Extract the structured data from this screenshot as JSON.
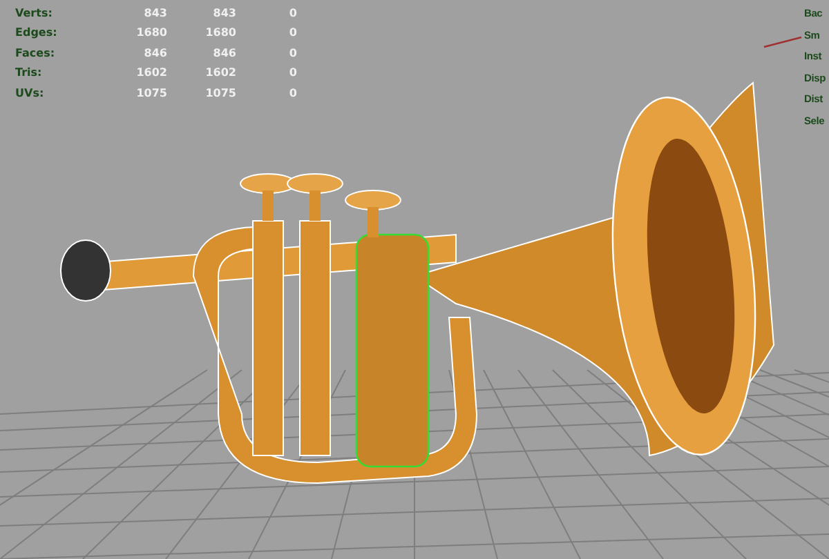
{
  "stats": [
    {
      "label": "Verts:",
      "values": [
        "843",
        "843",
        "0"
      ]
    },
    {
      "label": "Edges:",
      "values": [
        "1680",
        "1680",
        "0"
      ]
    },
    {
      "label": "Faces:",
      "values": [
        "846",
        "846",
        "0"
      ]
    },
    {
      "label": "Tris:",
      "values": [
        "1602",
        "1602",
        "0"
      ]
    },
    {
      "label": "UVs:",
      "values": [
        "1075",
        "1075",
        "0"
      ]
    }
  ],
  "side_labels": [
    "Bac",
    "Sm",
    "Inst",
    "Disp",
    "Dist",
    "Sele"
  ]
}
